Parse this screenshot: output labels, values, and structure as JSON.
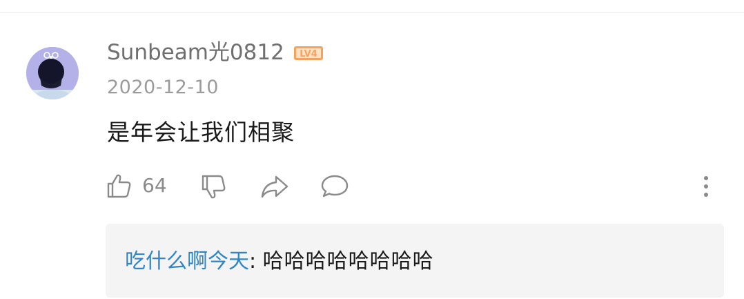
{
  "comment": {
    "username": "Sunbeam光0812",
    "level": "LV4",
    "date": "2020-12-10",
    "text": "是年会让我们相聚",
    "like_count": "64"
  },
  "reply": {
    "author": "吃什么啊今天",
    "separator": ":",
    "text": "哈哈哈哈哈哈哈哈"
  },
  "colors": {
    "username": "#6f6f6f",
    "date": "#9b9b9b",
    "level_badge": "#f5a25d",
    "reply_author": "#2e86c8",
    "reply_bg": "#f4f4f4",
    "icon": "#8a8a8a"
  },
  "icons": [
    "thumbs-up-icon",
    "thumbs-down-icon",
    "share-icon",
    "comment-bubble-icon",
    "more-vertical-icon"
  ]
}
